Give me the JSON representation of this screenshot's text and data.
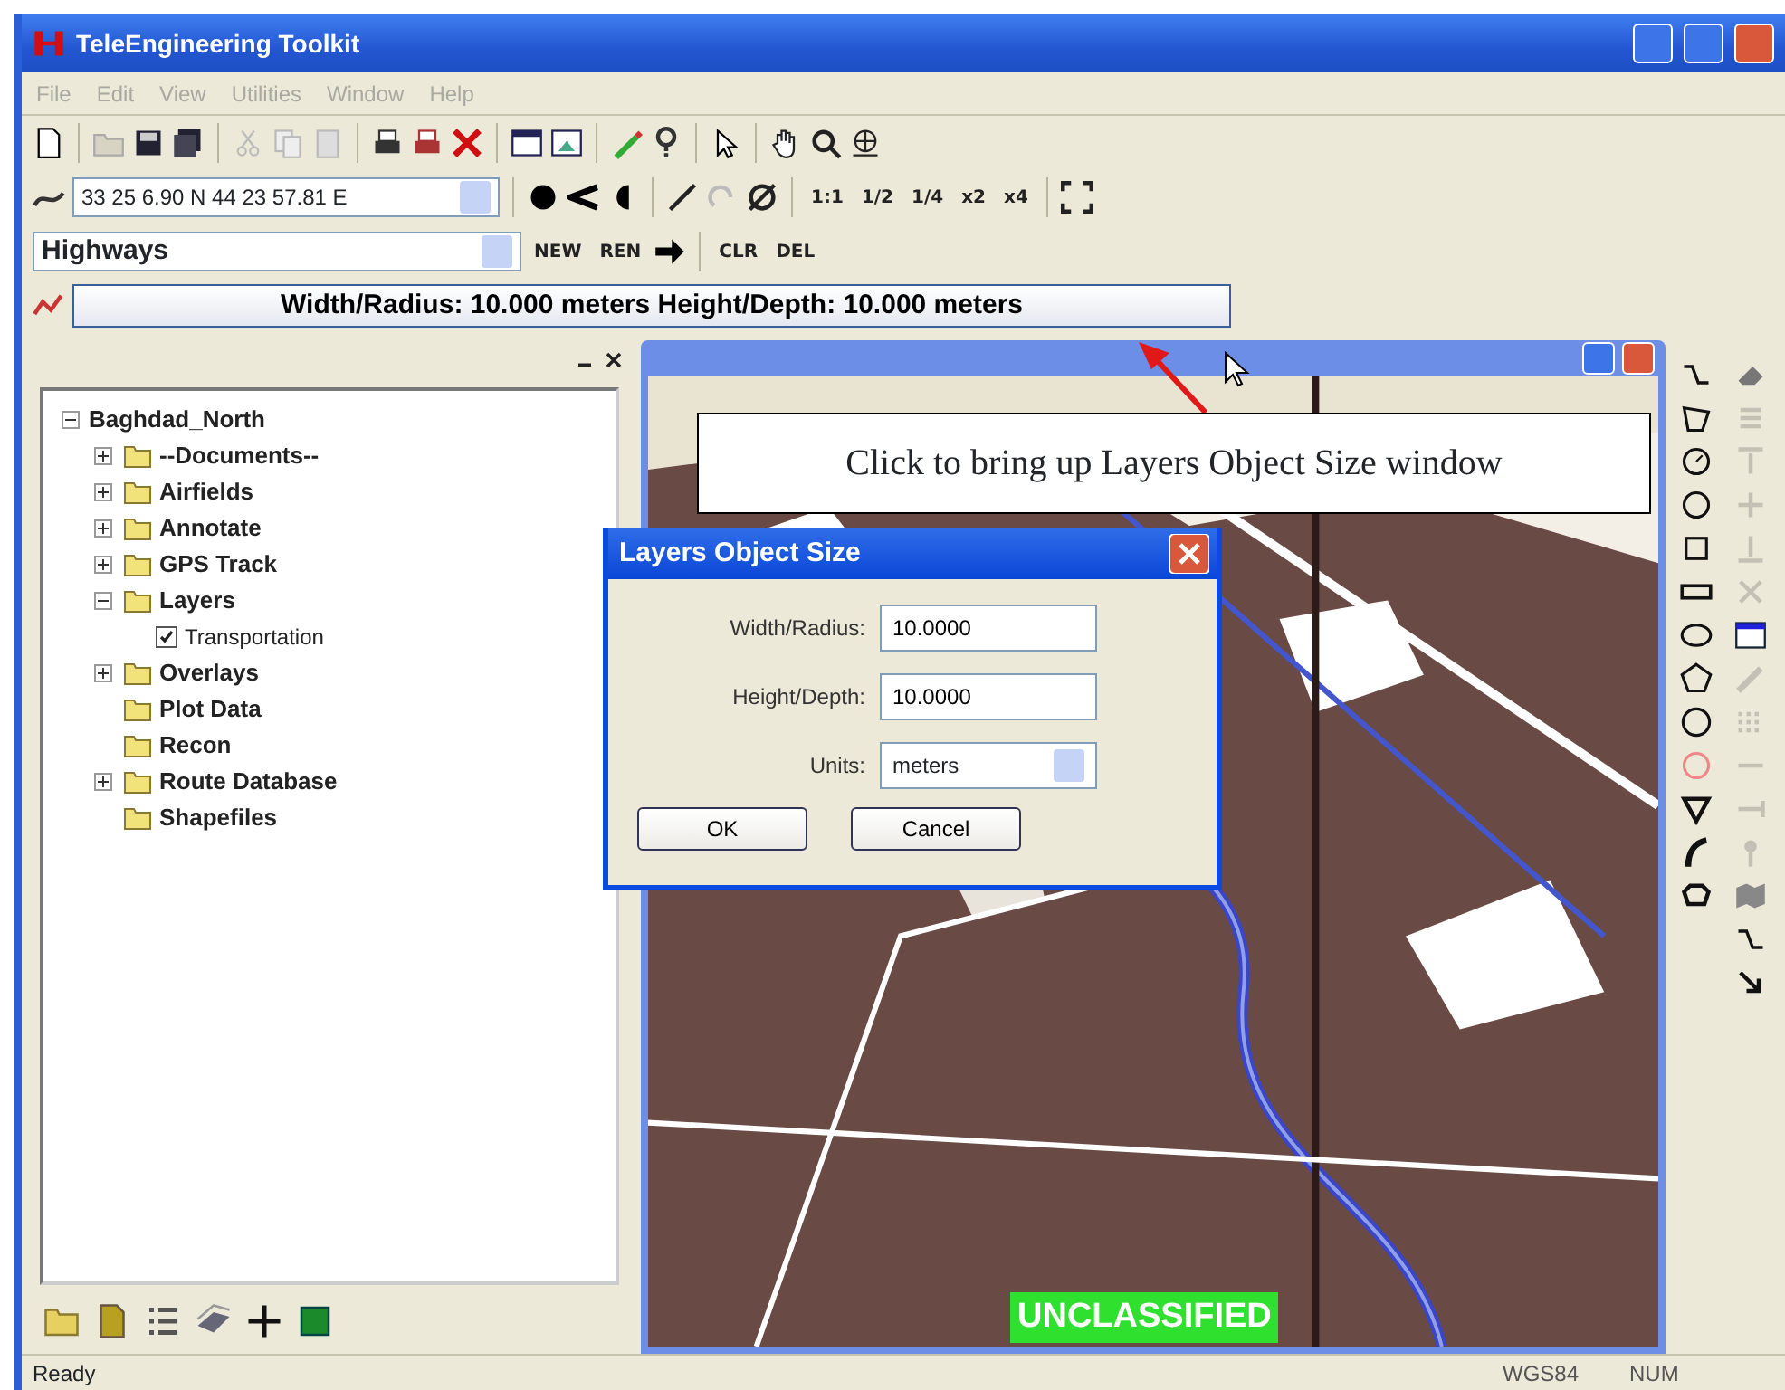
{
  "window": {
    "title": "TeleEngineering Toolkit"
  },
  "menu": [
    {
      "label": "File"
    },
    {
      "label": "Edit"
    },
    {
      "label": "View"
    },
    {
      "label": "Utilities"
    },
    {
      "label": "Window"
    },
    {
      "label": "Help"
    }
  ],
  "coordinate_field": {
    "value": "33 25 6.90 N 44 23 57.81 E"
  },
  "zoom_buttons": [
    "1:1",
    "1/2",
    "1/4",
    "x2",
    "x4"
  ],
  "layer_select": {
    "value": "Highways"
  },
  "layer_buttons": [
    "NEW",
    "REN",
    "CLR",
    "DEL"
  ],
  "size_button": {
    "label": "Width/Radius: 10.000 meters Height/Depth: 10.000 meters"
  },
  "tree": {
    "label": "Baghdad_North",
    "expanded": true,
    "children": [
      {
        "label": "--Documents--",
        "kind": "folder",
        "expanded": false
      },
      {
        "label": "Airfields",
        "kind": "folder",
        "expanded": false
      },
      {
        "label": "Annotate",
        "kind": "folder",
        "expanded": false
      },
      {
        "label": "GPS Track",
        "kind": "folder",
        "expanded": false
      },
      {
        "label": "Layers",
        "kind": "folder",
        "expanded": true,
        "children": [
          {
            "label": "Transportation",
            "kind": "check",
            "checked": true
          }
        ]
      },
      {
        "label": "Overlays",
        "kind": "folder",
        "expanded": false
      },
      {
        "label": "Plot Data",
        "kind": "folder"
      },
      {
        "label": "Recon",
        "kind": "folder"
      },
      {
        "label": "Route Database",
        "kind": "folder",
        "expanded": false
      },
      {
        "label": "Shapefiles",
        "kind": "folder"
      }
    ]
  },
  "map_window": {
    "banner": "UNCLASSIFIED"
  },
  "callout": "Click to bring up Layers Object Size window",
  "dialog": {
    "title": "Layers Object Size",
    "fields": [
      {
        "label": "Width/Radius:",
        "value": "10.0000",
        "kind": "text"
      },
      {
        "label": "Height/Depth:",
        "value": "10.0000",
        "kind": "text"
      },
      {
        "label": "Units:",
        "value": "meters",
        "kind": "select"
      }
    ],
    "buttons": [
      "OK",
      "Cancel"
    ]
  },
  "status_bar": {
    "message": "Ready",
    "datum": "WGS84",
    "numlock": "NUM"
  }
}
